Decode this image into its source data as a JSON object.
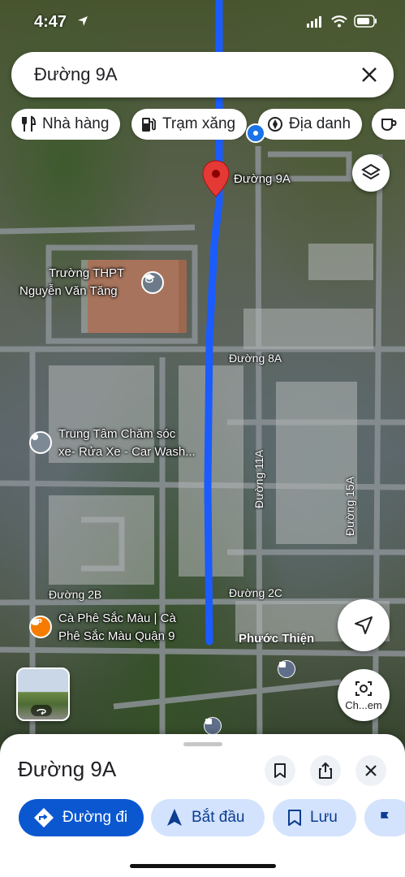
{
  "status_bar": {
    "time": "4:47"
  },
  "search": {
    "query": "Đường 9A"
  },
  "chips": [
    {
      "label": "Nhà hàng",
      "icon": "fork-knife-icon"
    },
    {
      "label": "Trạm xăng",
      "icon": "gas-pump-icon"
    },
    {
      "label": "Địa danh",
      "icon": "landmark-icon"
    }
  ],
  "map": {
    "selected_pin_label": "Đường 9A",
    "roads": {
      "road_8a": "Đường 8A",
      "road_11a": "Đường 11A",
      "road_15a": "Đường 15A",
      "road_2b": "Đường 2B",
      "road_2c": "Đường 2C",
      "area": "Phước Thiện"
    },
    "places": {
      "school_line1": "Trường THPT",
      "school_line2": "Nguyễn Văn Tăng",
      "carwash_line1": "Trung Tâm Chăm sóc",
      "carwash_line2": "xe- Rửa Xe - Car Wash...",
      "cafe_line1": "Cà Phê Sắc Màu | Cà",
      "cafe_line2": "Phê Sắc Màu Quận 9"
    },
    "streetview_label": "Ch...em",
    "route_color": "#1a5cff",
    "pin_color": "#e53935"
  },
  "sheet": {
    "title": "Đường 9A",
    "actions": {
      "directions": "Đường đi",
      "start": "Bắt đầu",
      "save": "Lưu"
    },
    "accent": "#0b57d0"
  }
}
